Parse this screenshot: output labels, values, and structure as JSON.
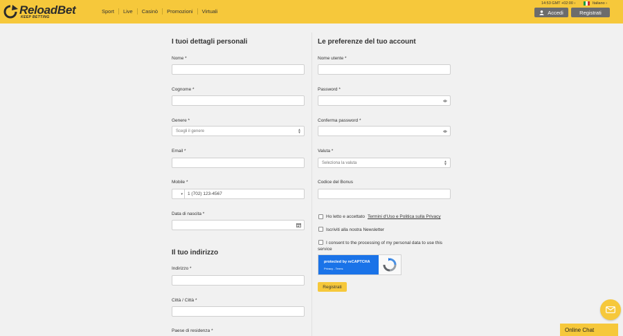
{
  "header": {
    "logo_text": "ReloadBet",
    "logo_sub": "KEEP BETTING",
    "nav": [
      "Sport",
      "Live",
      "Casinò",
      "Promozioni",
      "Virtuali"
    ],
    "clock": "14:53  GMT +02:00 ›",
    "language": "Italiano ›",
    "login_label": "Accedi",
    "register_label": "Registrati"
  },
  "personal": {
    "title": "I tuoi dettagli personali",
    "nome_label": "Nome *",
    "cognome_label": "Cognome *",
    "genere_label": "Genere *",
    "genere_value": "Scegli il genere",
    "email_label": "Email *",
    "mobile_label": "Mobile *",
    "mobile_placeholder": "1 (702) 123-4567",
    "dob_label": "Data di nascita *"
  },
  "address": {
    "title": "Il tuo indirizzo",
    "indirizzo_label": "Indirizzo *",
    "citta_label": "Città / Città *",
    "paese_label": "Paese di residenza *"
  },
  "account": {
    "title": "Le preferenze del tuo account",
    "username_label": "Nome utente *",
    "password_label": "Password *",
    "confirm_label": "Conferma password *",
    "currency_label": "Valuta *",
    "currency_value": "Seleziona la valuta",
    "bonus_label": "Codice del Bonus",
    "terms_text": "Ho letto e accettato",
    "terms_link": "Termini d'Uso e Politica sulla Privacy",
    "newsletter_text": "Iscriviti alla nostra Newsletter",
    "consent_text": "I consent to the processing of my personal data to use this",
    "consent_text2": "service",
    "recaptcha_title": "protected by reCAPTCHA",
    "recaptcha_links": "Privacy - Terms",
    "submit_label": "Registrati"
  },
  "chat": {
    "label": "Online Chat"
  },
  "colors": {
    "brand": "#f6c83b",
    "button_dark": "#6c6c6c",
    "recaptcha_blue": "#1a73e8"
  }
}
